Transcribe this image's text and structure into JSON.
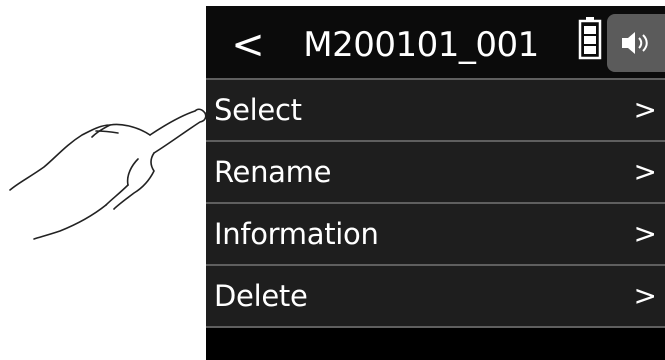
{
  "header": {
    "back_label": "<",
    "title": "M200101_001",
    "battery_icon": "battery-icon",
    "speaker_icon": "speaker-icon"
  },
  "menu": {
    "items": [
      {
        "label": "Select",
        "chevron": ">"
      },
      {
        "label": "Rename",
        "chevron": ">"
      },
      {
        "label": "Information",
        "chevron": ">"
      },
      {
        "label": "Delete",
        "chevron": ">"
      }
    ]
  },
  "colors": {
    "background": "#000000",
    "menu_row": "#1e1e1e",
    "divider": "#5f5f5f",
    "speaker_button": "#5b5b5b",
    "text": "#ffffff"
  }
}
